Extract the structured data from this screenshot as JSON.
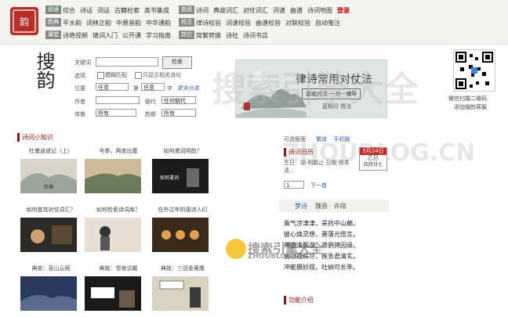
{
  "nav": {
    "rows": [
      {
        "badge": "阅读",
        "items": [
          "综合",
          "诗话",
          "词话",
          "古籍检索",
          "类书集成"
        ],
        "badge2": "查阅",
        "items2": [
          "诗词",
          "典故词汇",
          "对仗词汇",
          "词谱",
          "曲谱",
          "诗词地图"
        ],
        "extra": "登录"
      },
      {
        "badge": "韵典",
        "items": [
          "平水韵",
          "词林正韵",
          "中原音韵",
          "中华通韵"
        ],
        "badge2": "校注",
        "items2": [
          "律诗校验",
          "词谱校验",
          "曲谱校验",
          "对联校验",
          "自动笺注"
        ]
      },
      {
        "badge": "课堂",
        "items": [
          "诗艳视频",
          "填词入门",
          "公开课",
          "学习指南"
        ],
        "badge2": "其它",
        "items2": [
          "简繁转换",
          "诗社",
          "诗词书店"
        ]
      }
    ]
  },
  "search": {
    "logo_text": "搜韵",
    "keyword_label": "关键词",
    "search_button": "检索",
    "options_label": "选项",
    "option1": "模糊匹配",
    "option2": "只显示相关诗句",
    "position_label": "位置",
    "position_value": "任意",
    "pos_mid": "第",
    "pos_mid2": "字",
    "pos_val2": "任意",
    "help_link": "更多分类",
    "author_label": "作者",
    "dynasty_label": "朝代",
    "dynasty_value": "任何朝代",
    "genre_label": "体裁",
    "genre_value": "所有",
    "section_label": "韵部",
    "section_value": "所有"
  },
  "banner": {
    "title": "律诗常用对仗法",
    "subtitle": "基础对法·一对一辅导",
    "sign": "蓝相月 授法"
  },
  "qr": {
    "line1": "微信扫描二维码",
    "line2": "添加搜韵客服"
  },
  "watermarks": {
    "big": "搜索引擎大全",
    "latin": "ZHOUBLOG.CN",
    "small_cn": "搜索引擎大全",
    "small_latin": "ZHOUBLOG.CN"
  },
  "knowledge": {
    "title": "诗词小知识",
    "cards": [
      {
        "label": "杜甫逍遥记（上）"
      },
      {
        "label": "岑参，两度出塞"
      },
      {
        "label": "如何遣词用韵？"
      },
      {
        "label": "如何查找对仗词汇？"
      },
      {
        "label": "如何检索诗词库？"
      },
      {
        "label": "在外过年的唐诗人们"
      },
      {
        "label": "典故：巫山云雨"
      },
      {
        "label": "典故：雪夜访戴"
      },
      {
        "label": "典故：三百金黄鹰"
      }
    ]
  },
  "right": {
    "version_label": "可选版面：",
    "version1": "繁体",
    "version2": "手机版",
    "calendar_title": "诗词日历",
    "cal_date": "5月24日",
    "cal_day": "乙巳",
    "cal_lunar": "四月廿七",
    "cal_line": "生日：胡·明鹏止 日期 明本清…",
    "page_num": "1",
    "next_page": "下一首",
    "poem_title": "梦诗",
    "poem_author": "魏晋 · 许翊",
    "poem_lines": [
      "乘气涉津津，采药中山巅。",
      "披心焕灵想，萧落元悟言。",
      "神遊清丽游，骖鹞骋因缘。",
      "会须视珠尽，疾急君清玄。",
      "冲能摄妙观，吐纳可长年。"
    ],
    "feature_title": "功能介绍"
  },
  "colors": {
    "accent": "#8b1a1a",
    "badge": "#8a8a8a",
    "badge_active": "#7c8b78"
  }
}
